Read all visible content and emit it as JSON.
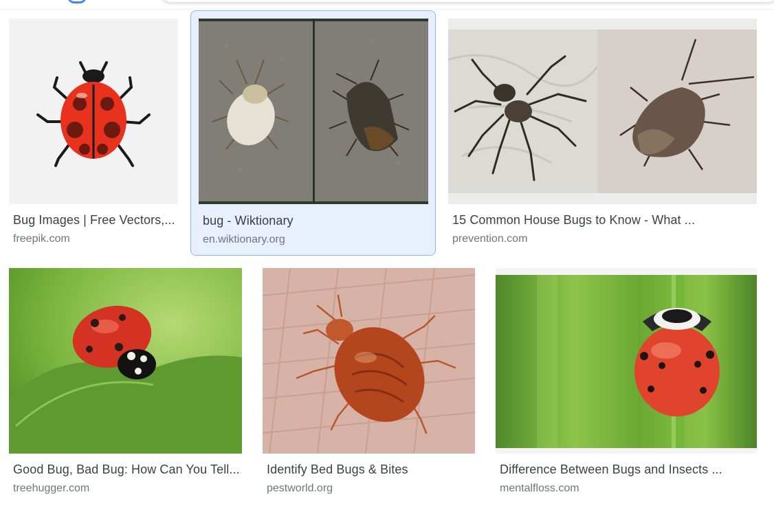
{
  "results": [
    {
      "title": "Bug Images | Free Vectors,...",
      "source": "freepik.com",
      "image": "ladybug-illustration"
    },
    {
      "title": "bug - Wiktionary",
      "source": "en.wiktionary.org",
      "image": "two-stink-bugs-photo"
    },
    {
      "title": "15 Common House Bugs to Know - What ...",
      "source": "prevention.com",
      "image": "spider-and-stinkbug-photo"
    },
    {
      "title": "Good Bug, Bad Bug: How Can You Tell...",
      "source": "treehugger.com",
      "image": "ladybug-on-leaf-photo"
    },
    {
      "title": "Identify Bed Bugs & Bites",
      "source": "pestworld.org",
      "image": "bed-bug-on-skin-photo"
    },
    {
      "title": "Difference Between Bugs and Insects ...",
      "source": "mentalfloss.com",
      "image": "ladybug-on-grass-photo"
    }
  ],
  "colors": {
    "selected_bg": "#e8f0fe",
    "selected_border": "#8ab4f8",
    "title": "#3c4043",
    "source": "#70757a"
  }
}
